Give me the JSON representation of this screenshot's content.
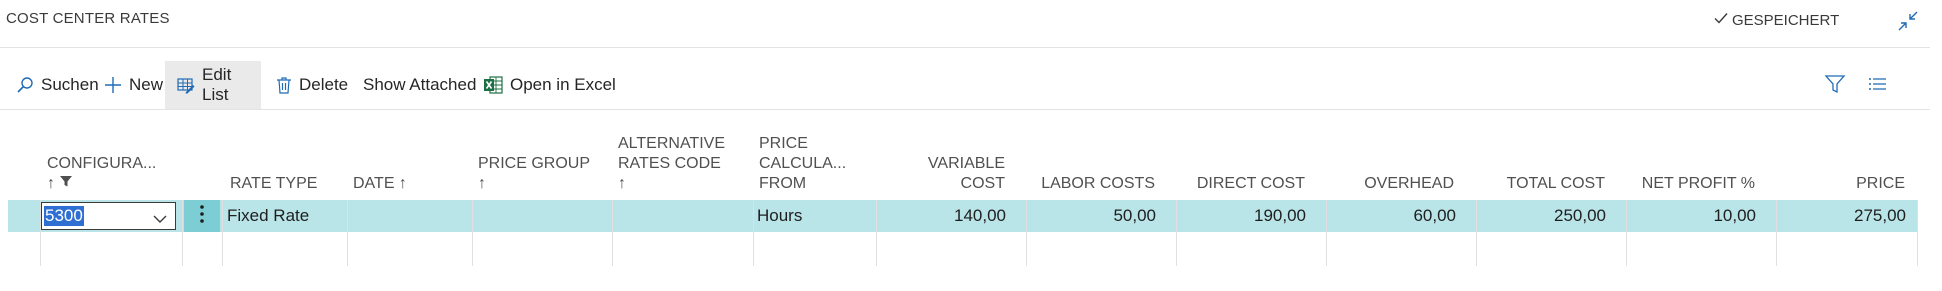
{
  "header": {
    "title": "COST CENTER RATES",
    "saved_label": "GESPEICHERT"
  },
  "toolbar": {
    "search_label": "Suchen",
    "new_label": "New",
    "edit_list_label": "Edit List",
    "delete_label": "Delete",
    "show_attached_label": "Show Attached",
    "open_excel_label": "Open in Excel"
  },
  "columns": {
    "configuration": "CONFIGURA...",
    "rate_type": "RATE TYPE",
    "date": "DATE ↑",
    "price_group_1": "PRICE GROUP",
    "price_group_2": "↑",
    "alt_rates_1": "ALTERNATIVE",
    "alt_rates_2": "RATES CODE",
    "alt_rates_3": "↑",
    "price_calc_1": "PRICE",
    "price_calc_2": "CALCULA...",
    "price_calc_3": "FROM",
    "variable_cost_1": "VARIABLE",
    "variable_cost_2": "COST",
    "labor_costs": "LABOR COSTS",
    "direct_cost": "DIRECT COST",
    "overhead": "OVERHEAD",
    "total_cost": "TOTAL COST",
    "net_profit": "NET PROFIT %",
    "price": "PRICE"
  },
  "row": {
    "configuration": "5300",
    "rate_type": "Fixed Rate",
    "date": "",
    "price_group": "",
    "alternative_rates_code": "",
    "price_calculation_from": "Hours",
    "variable_cost": "140,00",
    "labor_costs": "50,00",
    "direct_cost": "190,00",
    "overhead": "60,00",
    "total_cost": "250,00",
    "net_profit_pct": "10,00",
    "price": "275,00"
  },
  "colors": {
    "selected_row": "#b9e4e8",
    "selected_row_action": "#7ccdd4",
    "excel_green": "#1d7044",
    "accent_blue": "#1f6bb5"
  }
}
